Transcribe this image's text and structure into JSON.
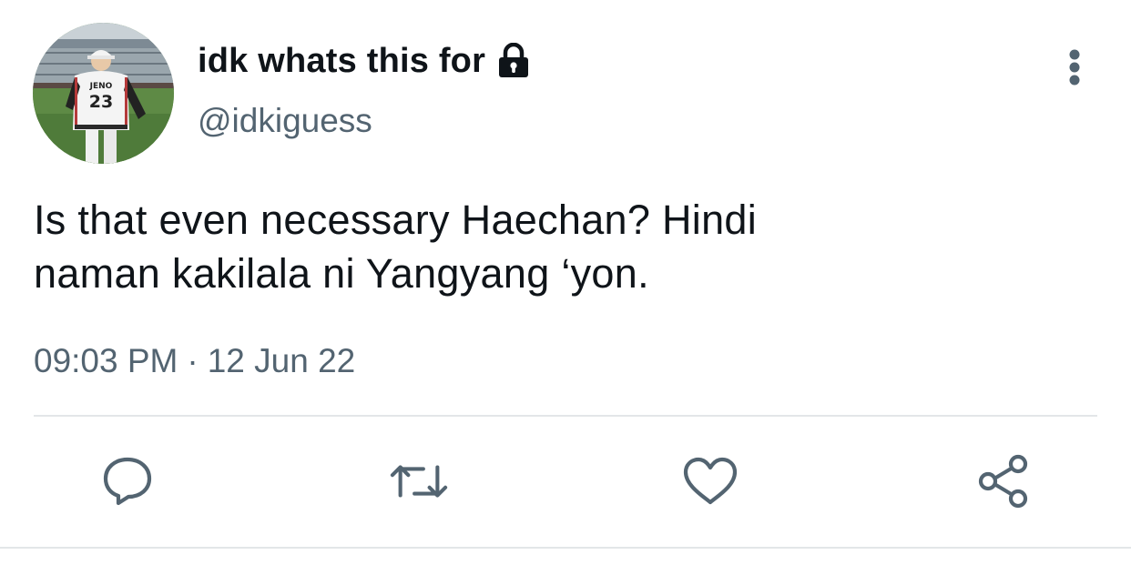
{
  "tweet": {
    "display_name": "idk whats this for",
    "handle": "@idkiguess",
    "text_line_1": "Is that even necessary Haechan? Hindi",
    "text_line_2": "naman kakilala ni Yangyang ‘yon.",
    "time": "09:03 PM",
    "separator": "·",
    "date": "12 Jun 22",
    "protected": true,
    "avatar_jersey_name": "JENO",
    "avatar_jersey_number": "23"
  },
  "icons": {
    "lock": "lock-icon",
    "more": "more-vertical-icon",
    "reply": "reply-icon",
    "retweet": "retweet-icon",
    "like": "heart-icon",
    "share": "share-icon"
  },
  "colors": {
    "text_primary": "#0f1419",
    "text_secondary": "#536471",
    "icon": "#536471",
    "divider": "#e3e6e8"
  }
}
